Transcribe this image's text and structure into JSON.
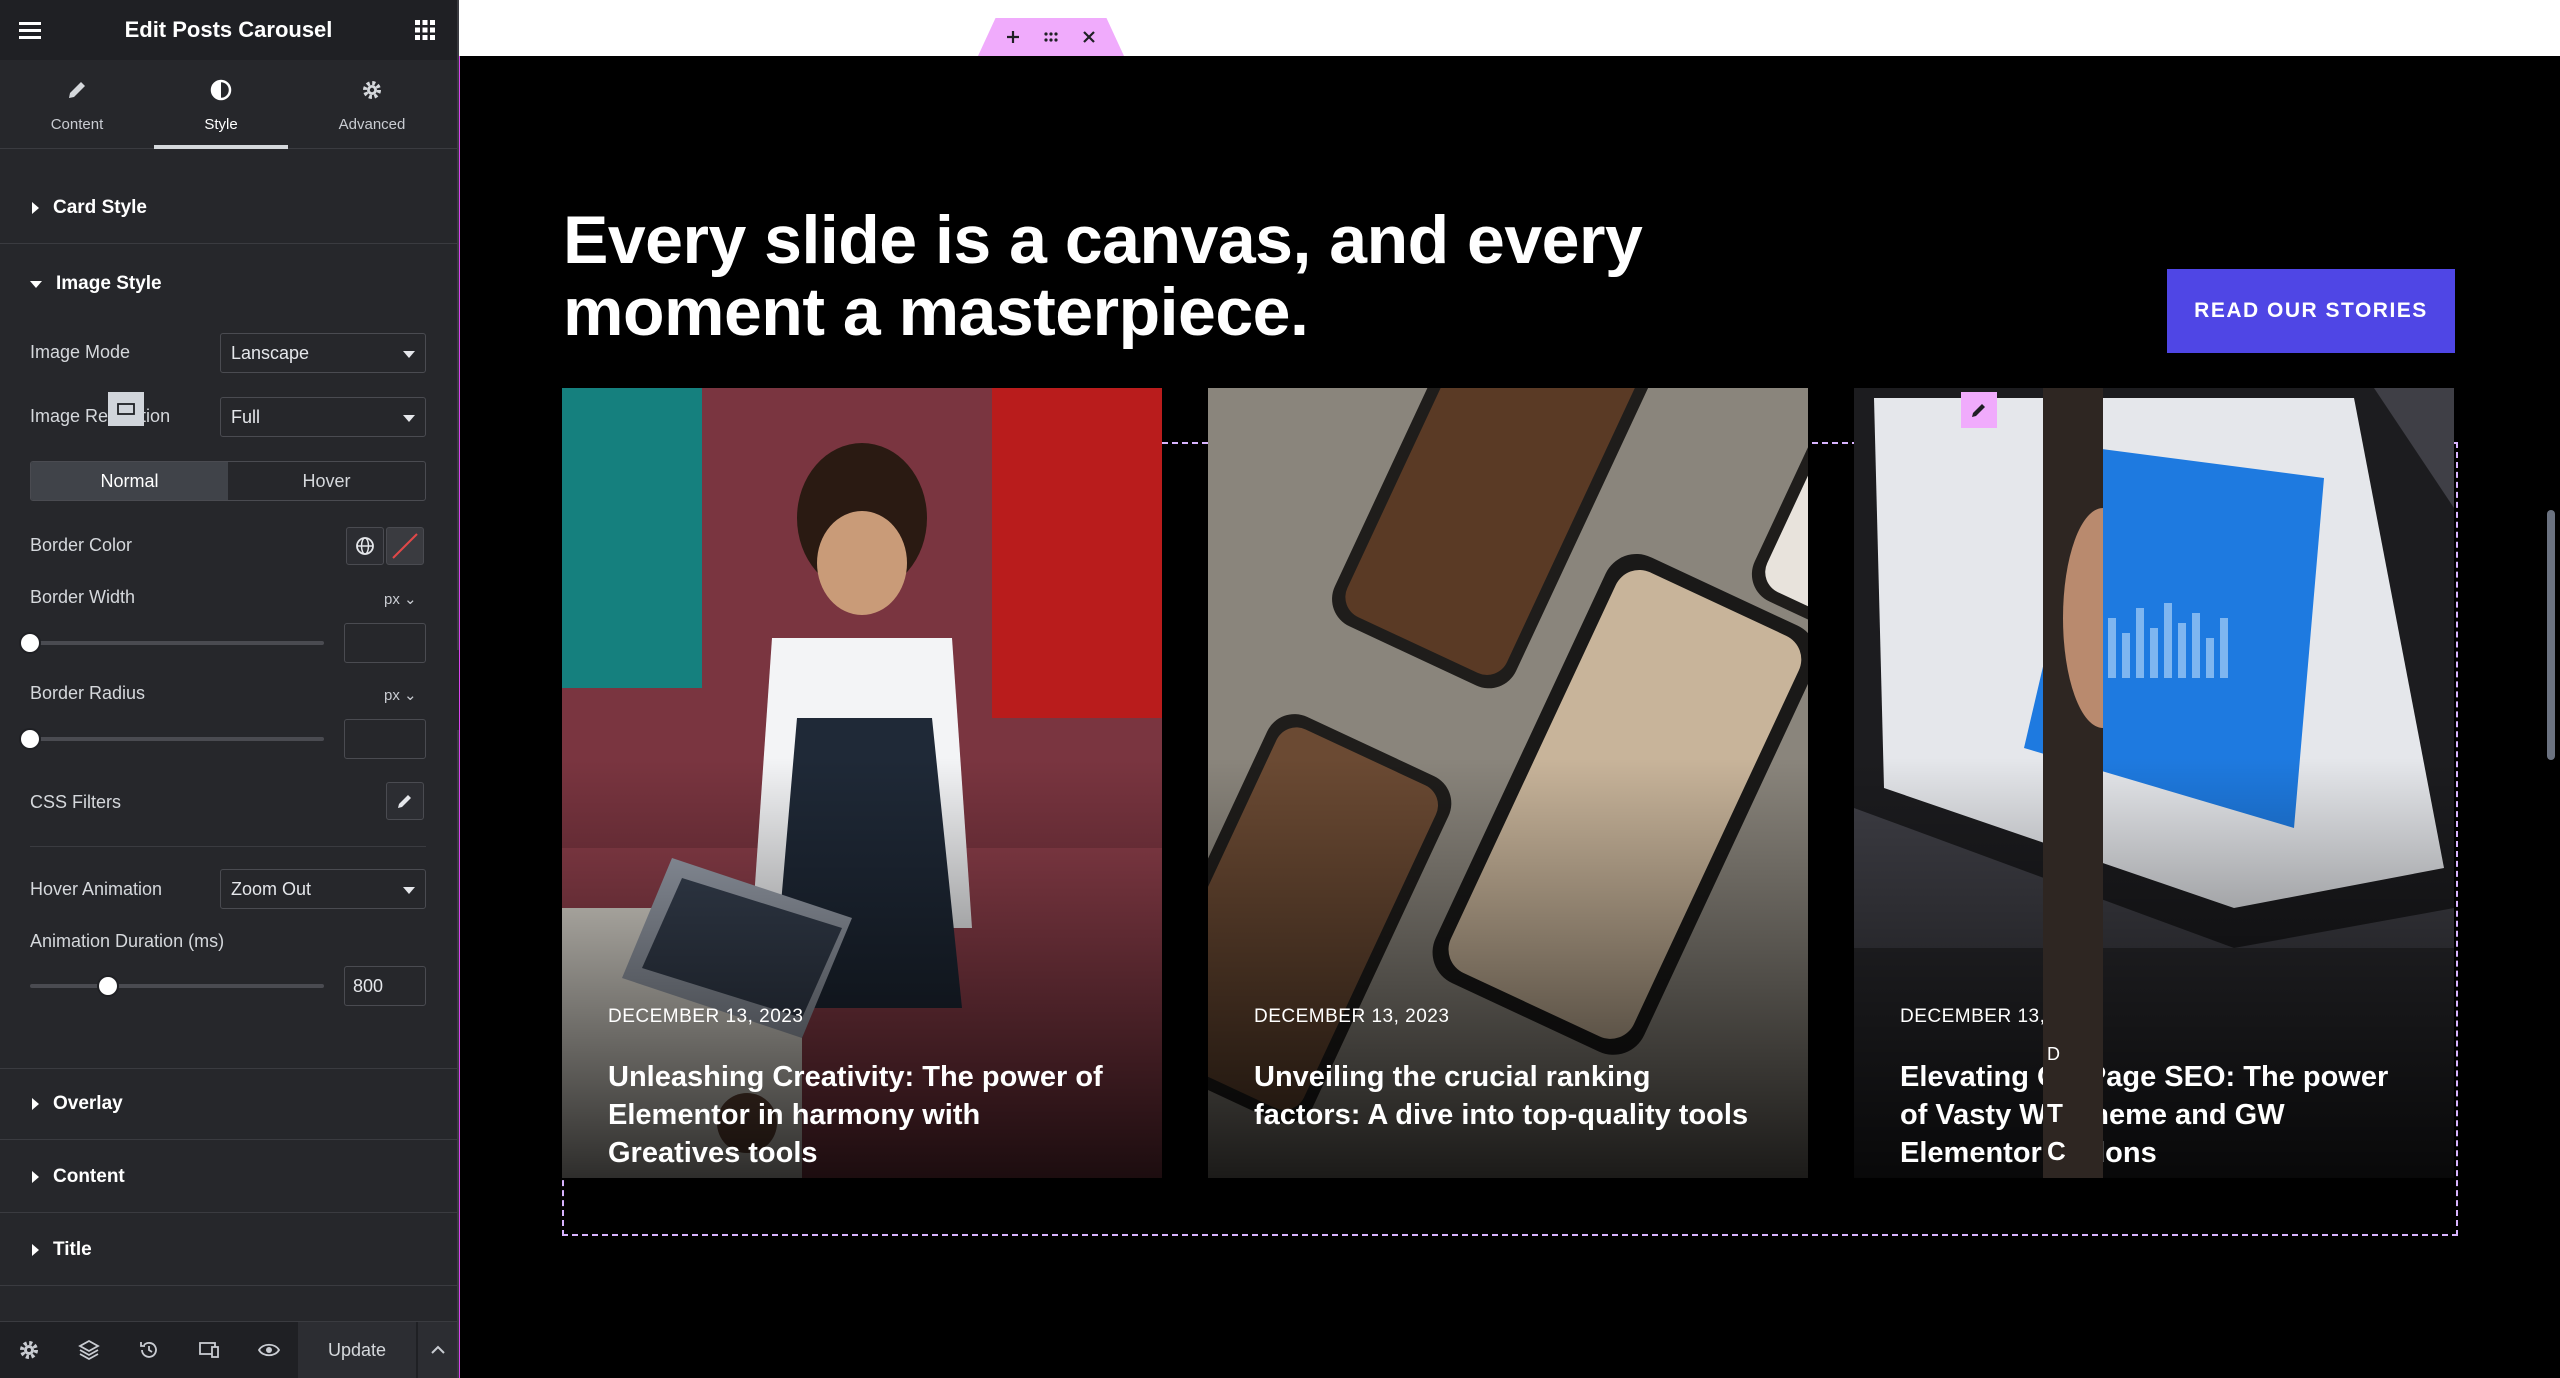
{
  "panel": {
    "title": "Edit Posts Carousel",
    "tabs": [
      {
        "label": "Content",
        "icon": "pencil-icon"
      },
      {
        "label": "Style",
        "icon": "half-circle-icon"
      },
      {
        "label": "Advanced",
        "icon": "gear-icon"
      }
    ],
    "active_tab": "Style",
    "sections": {
      "card_style": "Card Style",
      "image_style": "Image Style",
      "overlay": "Overlay",
      "content": "Content",
      "title": "Title"
    },
    "image_style": {
      "image_mode": {
        "label": "Image Mode",
        "value": "Lanscape"
      },
      "image_resolution": {
        "label": "Image Resolution",
        "value": "Full"
      },
      "state_normal": "Normal",
      "state_hover": "Hover",
      "border_color_label": "Border Color",
      "border_width": {
        "label": "Border Width",
        "unit": "px",
        "value": ""
      },
      "border_radius": {
        "label": "Border Radius",
        "unit": "px",
        "value": ""
      },
      "css_filters_label": "CSS Filters",
      "hover_animation": {
        "label": "Hover Animation",
        "value": "Zoom Out"
      },
      "animation_duration": {
        "label": "Animation Duration (ms)",
        "value": "800"
      }
    },
    "footer": {
      "update_label": "Update"
    }
  },
  "canvas": {
    "headline": "Every slide is a canvas, and every moment a masterpiece.",
    "cta_label": "READ OUR STORIES",
    "accent": "#4f46e5",
    "cards": [
      {
        "date": "DECEMBER 13, 2023",
        "title": "Unleashing Creativity: The power of Elementor in harmony with Greatives tools"
      },
      {
        "date": "DECEMBER 13, 2023",
        "title": "Unveiling the crucial ranking factors: A dive into top-quality tools"
      },
      {
        "date": "DECEMBER 13, 2023",
        "title": "Elevating On-Page SEO: The power of Vasty WP Theme and GW Elementor Addons"
      }
    ],
    "peek_card": {
      "date_initial": "D",
      "title_initials": [
        "T",
        "C"
      ]
    }
  }
}
